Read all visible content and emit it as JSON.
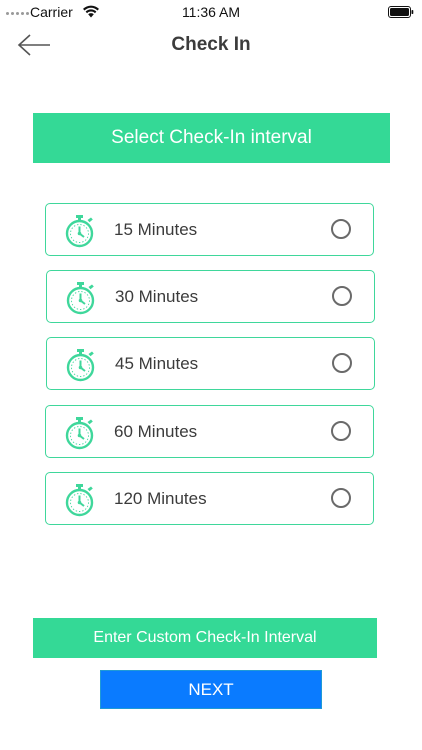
{
  "status_bar": {
    "carrier": "Carrier",
    "time": "11:36 AM"
  },
  "nav": {
    "title": "Check In",
    "back_icon": "back-arrow-icon"
  },
  "section": {
    "header": "Select Check-In interval"
  },
  "options": [
    {
      "label": "15 Minutes",
      "icon": "stopwatch-icon",
      "selected": false
    },
    {
      "label": "30 Minutes",
      "icon": "stopwatch-icon",
      "selected": false
    },
    {
      "label": "45 Minutes",
      "icon": "stopwatch-icon",
      "selected": false
    },
    {
      "label": "60 Minutes",
      "icon": "stopwatch-icon",
      "selected": false
    },
    {
      "label": "120 Minutes",
      "icon": "stopwatch-icon",
      "selected": false
    }
  ],
  "buttons": {
    "custom": "Enter Custom Check-In Interval",
    "next": "NEXT"
  },
  "colors": {
    "accent_green": "#34d996",
    "next_blue": "#0a7bff"
  }
}
